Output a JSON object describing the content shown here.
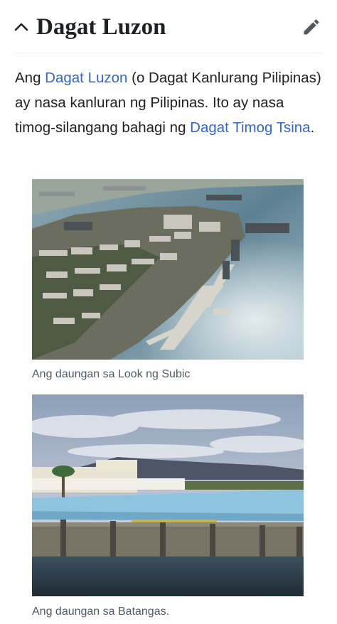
{
  "section": {
    "title": "Dagat Luzon"
  },
  "intro": {
    "t1": "Ang ",
    "link1": "Dagat Luzon",
    "t2": " (o Dagat Kanlurang Pilipinas) ay nasa kanluran ng Pilipinas. Ito ay nasa timog-silangang bahagi ng ",
    "link2": "Dagat Timog Tsina",
    "t3": "."
  },
  "figures": [
    {
      "caption": "Ang daungan sa Look ng Subic"
    },
    {
      "caption": "Ang daungan sa Batangas."
    }
  ],
  "icons": {
    "collapse": "chevron-up-icon",
    "edit": "pencil-icon"
  },
  "colors": {
    "link": "#3366cc",
    "text": "#202122",
    "caption": "#54595d",
    "divider": "#eaecf0",
    "icon": "#54595d"
  }
}
